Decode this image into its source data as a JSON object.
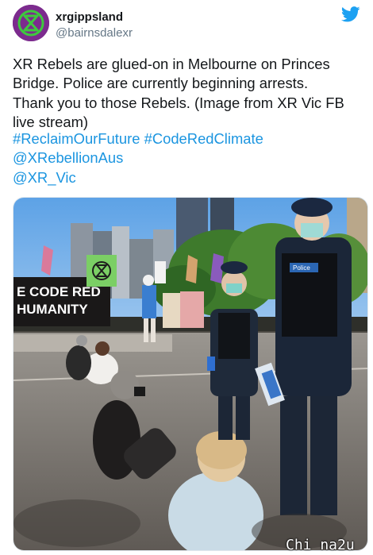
{
  "account": {
    "display_name": "xrgippsland",
    "handle": "@bairnsdalexr"
  },
  "tweet": {
    "text": "XR Rebels are glued-on in Melbourne on Princes\nBridge. Police are currently beginning arrests.\nThank you to those Rebels. (Image from XR Vic FB\nlive stream)",
    "hashtags": [
      "#ReclaimOurFuture",
      "#CodeRedClimate"
    ],
    "mentions": [
      "@XRebellionAus",
      "@XR_Vic"
    ]
  },
  "photo": {
    "banner_text_line1": "E CODE RED",
    "banner_text_line2": "HUMANITY",
    "police_badge_text": "Police"
  },
  "watermark": "Chi na2u",
  "colors": {
    "link": "#1b95e0",
    "twitter_blue": "#1da1f2",
    "xr_green": "#3ec93e",
    "avatar_purple": "#7c2b8e"
  },
  "icons": [
    "twitter-bird-icon",
    "xr-logo-icon"
  ]
}
